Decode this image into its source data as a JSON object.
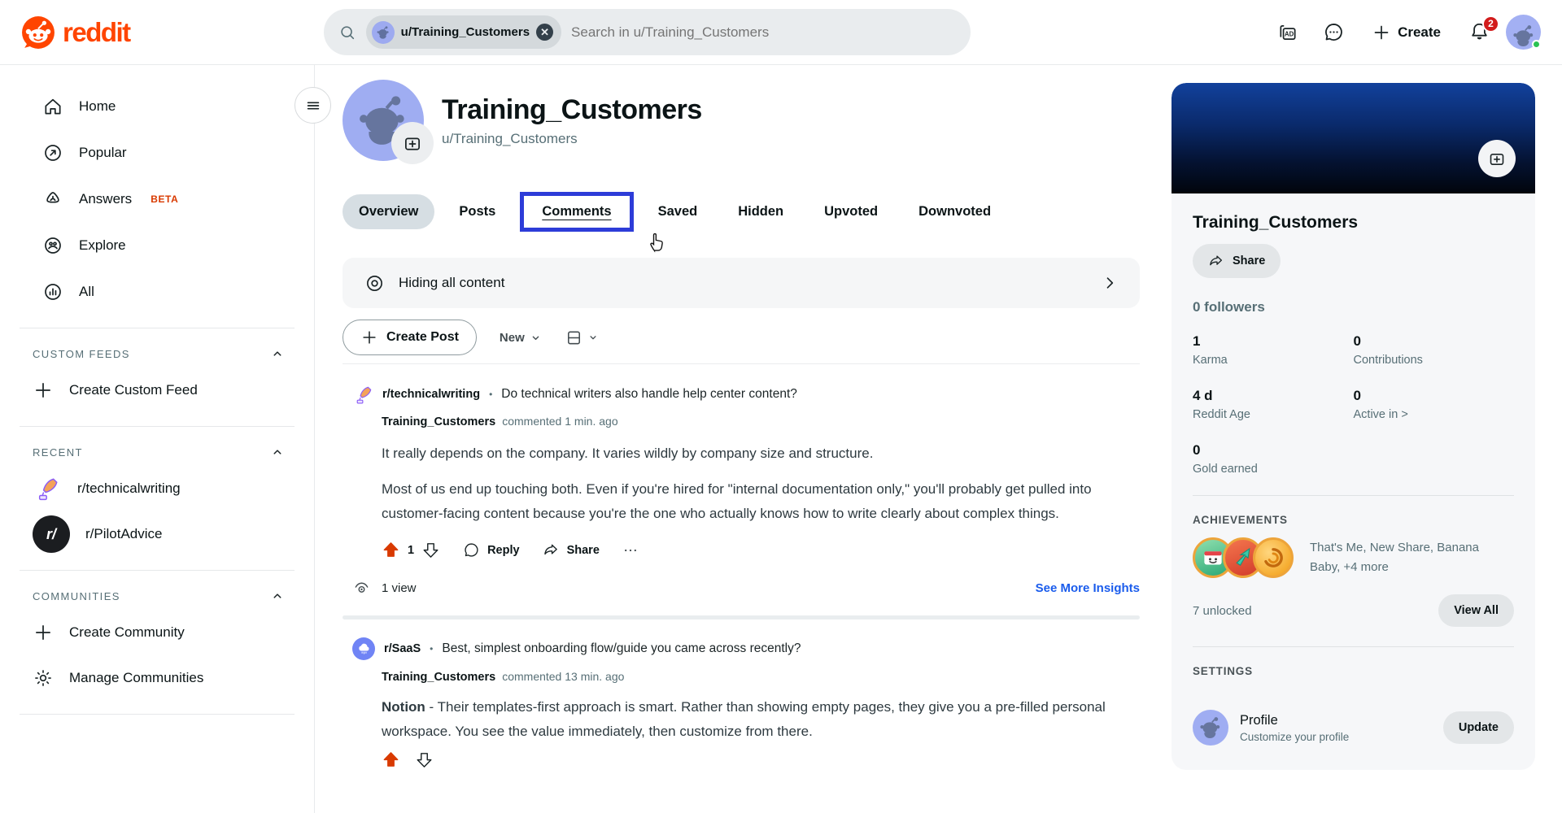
{
  "header": {
    "logo_text": "reddit",
    "search": {
      "chip_label": "u/Training_Customers",
      "placeholder": "Search in u/Training_Customers"
    },
    "ad_label": "AD",
    "create_label": "Create",
    "notification_count": "2"
  },
  "sidebar": {
    "nav": [
      {
        "label": "Home"
      },
      {
        "label": "Popular"
      },
      {
        "label": "Answers",
        "badge": "BETA"
      },
      {
        "label": "Explore"
      },
      {
        "label": "All"
      }
    ],
    "custom_feeds": {
      "title": "CUSTOM FEEDS",
      "create_label": "Create Custom Feed"
    },
    "recent": {
      "title": "RECENT",
      "items": [
        {
          "label": "r/technicalwriting"
        },
        {
          "label": "r/PilotAdvice",
          "avatar_text": "r/"
        }
      ]
    },
    "communities": {
      "title": "COMMUNITIES",
      "create_label": "Create Community",
      "manage_label": "Manage Communities"
    }
  },
  "profile": {
    "title": "Training_Customers",
    "handle": "u/Training_Customers"
  },
  "tabs": [
    {
      "label": "Overview"
    },
    {
      "label": "Posts"
    },
    {
      "label": "Comments"
    },
    {
      "label": "Saved"
    },
    {
      "label": "Hidden"
    },
    {
      "label": "Upvoted"
    },
    {
      "label": "Downvoted"
    }
  ],
  "feed": {
    "hiding_banner": "Hiding all content",
    "create_post_label": "Create Post",
    "sort_label": "New",
    "comments": [
      {
        "community": "r/technicalwriting",
        "separator": "•",
        "post_title": "Do technical writers also handle help center content?",
        "author": "Training_Customers",
        "meta": "commented 1 min. ago",
        "para1": "It really depends on the company. It varies wildly by company size and structure.",
        "para2": "Most of us end up touching both. Even if you're hired for \"internal documentation only,\" you'll probably get pulled into customer-facing content because you're the one who actually knows how to write clearly about complex things.",
        "votes": "1",
        "reply_label": "Reply",
        "share_label": "Share",
        "views": "1 view",
        "insights_label": "See More Insights"
      },
      {
        "community": "r/SaaS",
        "separator": "•",
        "post_title": "Best, simplest onboarding flow/guide you came across recently?",
        "author": "Training_Customers",
        "meta": "commented 13 min. ago",
        "body_lead": "Notion",
        "body_rest": " - Their templates-first approach is smart. Rather than showing empty pages, they give you a pre-filled personal workspace. You see the value immediately, then customize from there."
      }
    ]
  },
  "profile_card": {
    "name": "Training_Customers",
    "share_label": "Share",
    "followers": "0 followers",
    "stats": [
      {
        "value": "1",
        "label": "Karma"
      },
      {
        "value": "0",
        "label": "Contributions"
      },
      {
        "value": "4 d",
        "label": "Reddit Age"
      },
      {
        "value": "0",
        "label": "Active in >"
      },
      {
        "value": "0",
        "label": "Gold earned"
      }
    ],
    "achievements": {
      "title": "ACHIEVEMENTS",
      "summary": "That's Me, New Share, Banana Baby, +4 more",
      "unlocked": "7 unlocked",
      "view_all_label": "View All"
    },
    "settings": {
      "title": "SETTINGS",
      "profile_label": "Profile",
      "profile_sub": "Customize your profile",
      "update_label": "Update"
    }
  },
  "colors": {
    "brand_orange": "#FF4500",
    "upvote_red": "#D93A00",
    "link_blue": "#1A5CEC",
    "highlight_blue": "#2D3CD8",
    "badge_red": "#D21C1C"
  }
}
